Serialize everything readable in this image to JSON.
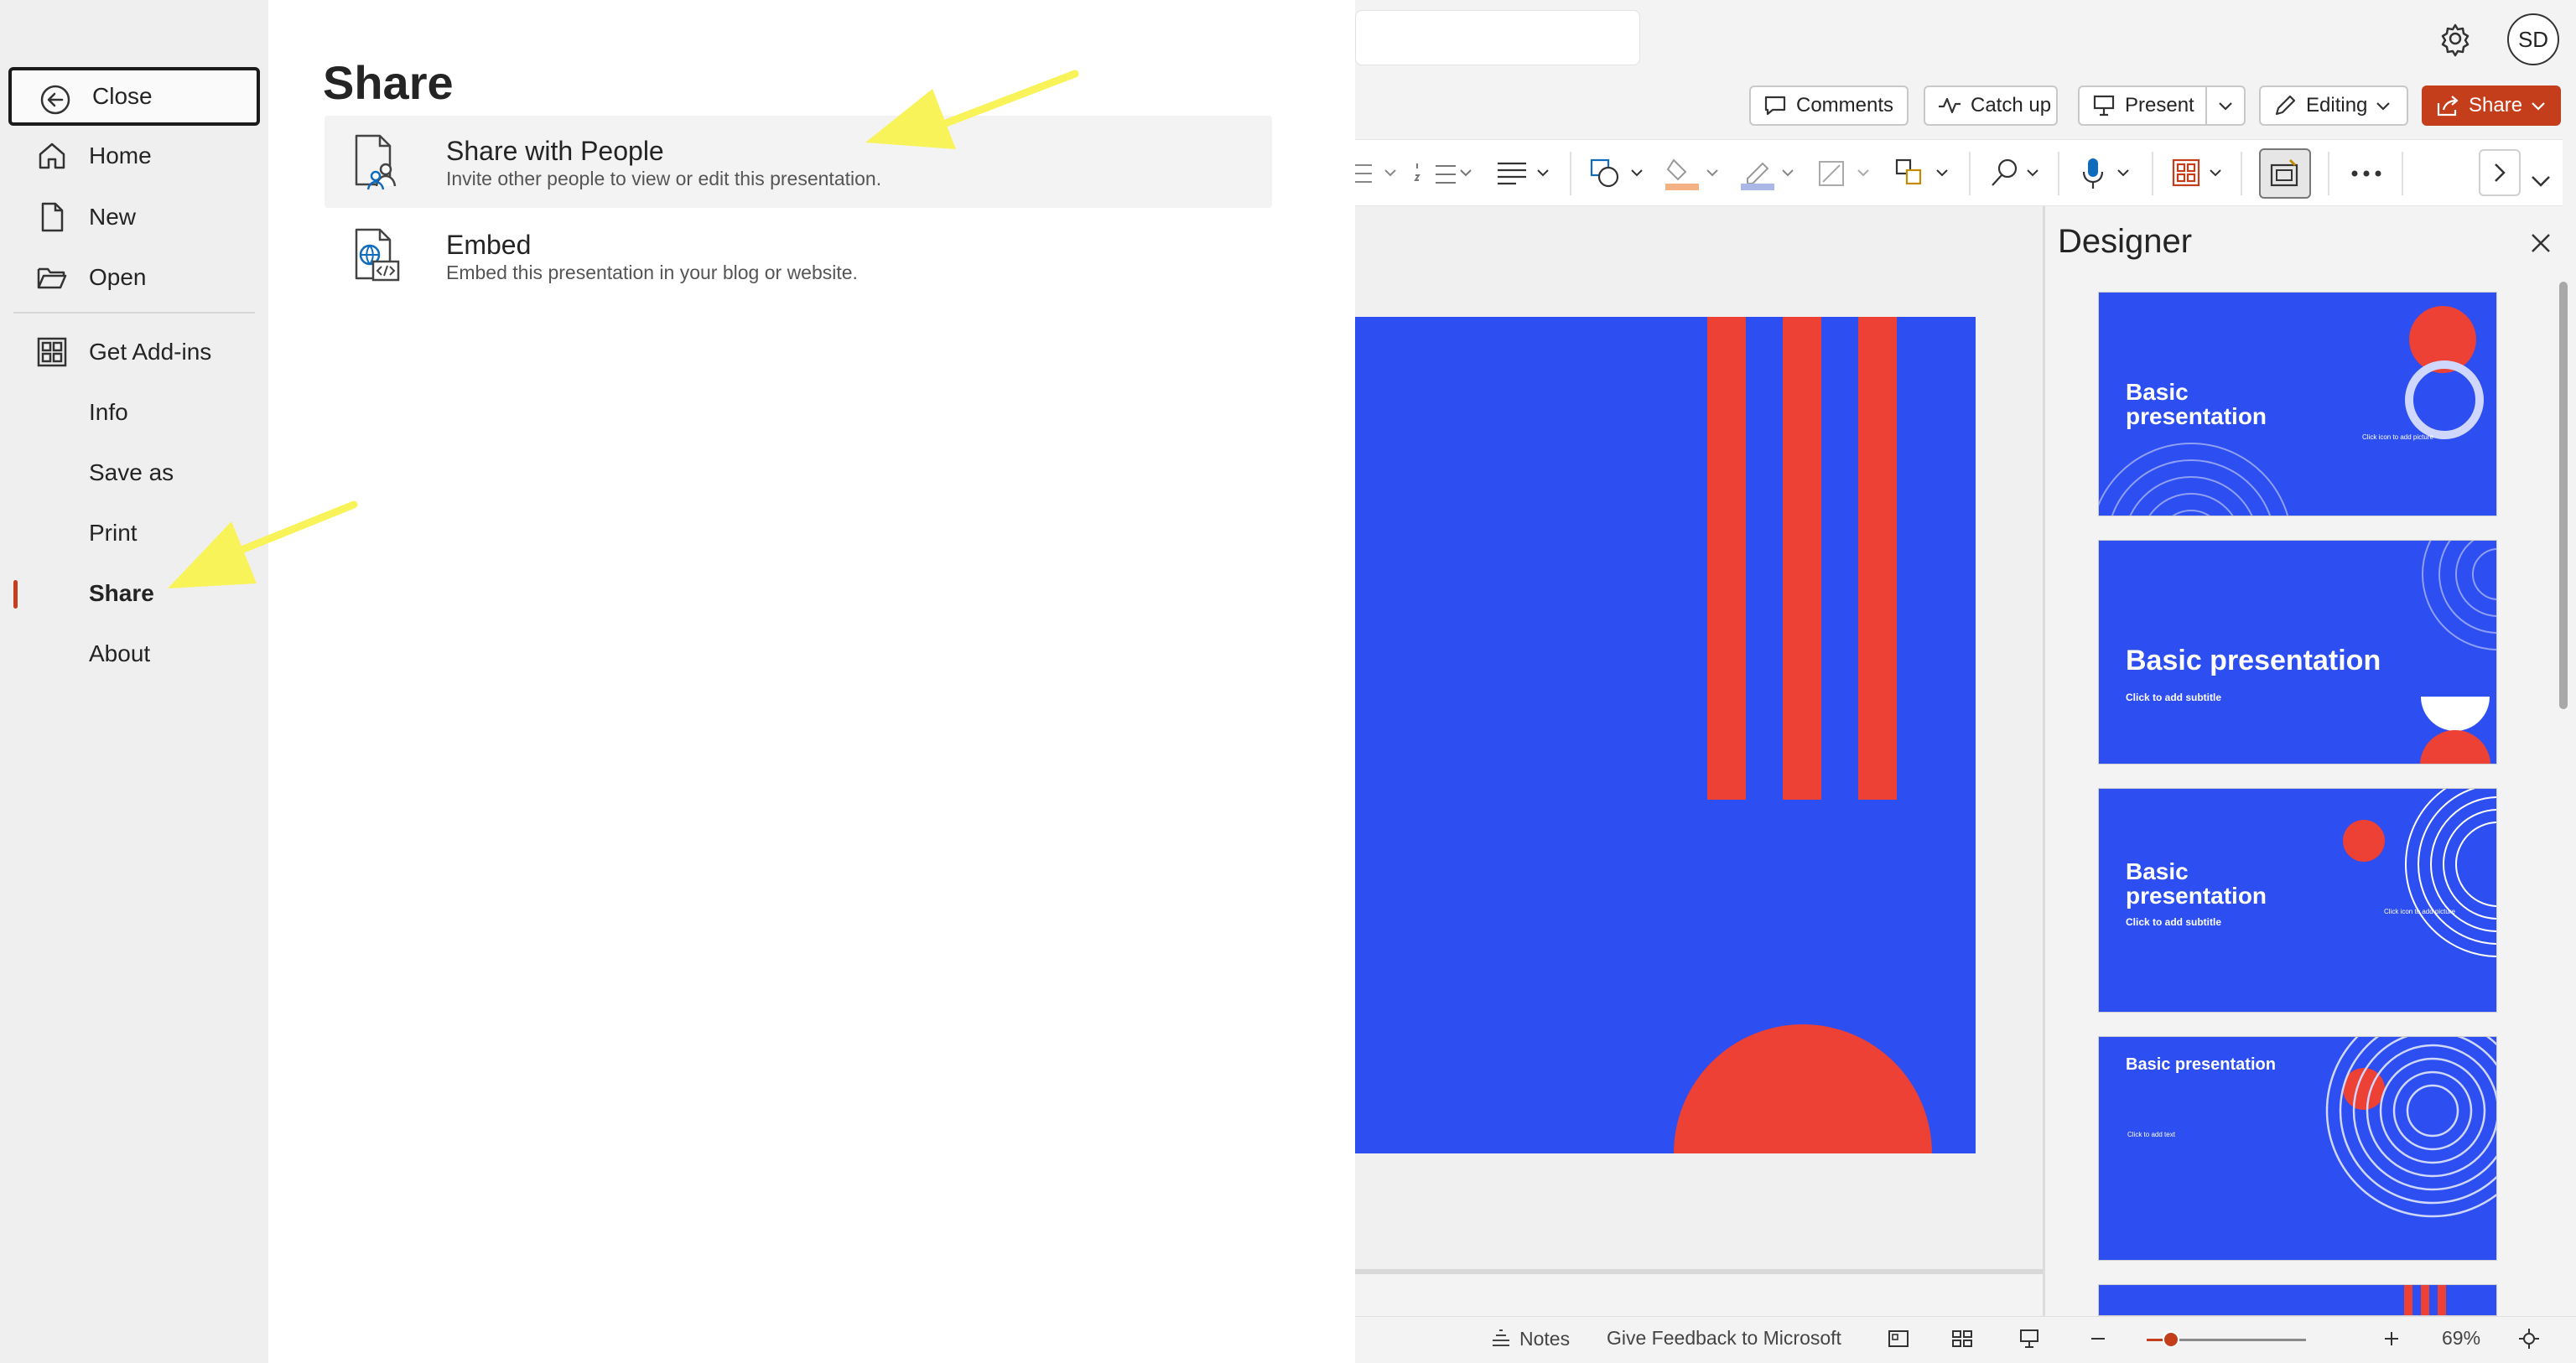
{
  "nav": {
    "close": "Close",
    "home": "Home",
    "new": "New",
    "open": "Open",
    "get_addins": "Get Add-ins",
    "info": "Info",
    "save_as": "Save as",
    "print": "Print",
    "share": "Share",
    "about": "About",
    "selected": "Share"
  },
  "share_panel": {
    "title": "Share",
    "options": [
      {
        "title": "Share with People",
        "description": "Invite other people to view or edit this presentation.",
        "icon": "share-with-people-icon"
      },
      {
        "title": "Embed",
        "description": "Embed this presentation in your blog or website.",
        "icon": "embed-icon"
      }
    ]
  },
  "header": {
    "avatar_initials": "SD",
    "comments": "Comments",
    "catch_up": "Catch up",
    "present": "Present",
    "editing": "Editing",
    "share": "Share"
  },
  "designer": {
    "title": "Designer",
    "thumbnails": [
      {
        "title": "Basic presentation",
        "caption": "Click icon to add picture"
      },
      {
        "title": "Basic presentation",
        "caption": "Click to add subtitle"
      },
      {
        "title": "Basic presentation",
        "caption": "Click to add subtitle",
        "caption2": "Click icon to add picture"
      },
      {
        "title": "Basic presentation",
        "caption": "Click to add text"
      }
    ]
  },
  "statusbar": {
    "notes": "Notes",
    "feedback": "Give Feedback to Microsoft",
    "zoom": "69%",
    "zoom_level": 0.69
  },
  "colors": {
    "accent": "#c43e1c",
    "slide_blue": "#2d4ef0",
    "slide_red": "#ec4134",
    "annotation_arrow": "#f9f35a"
  }
}
